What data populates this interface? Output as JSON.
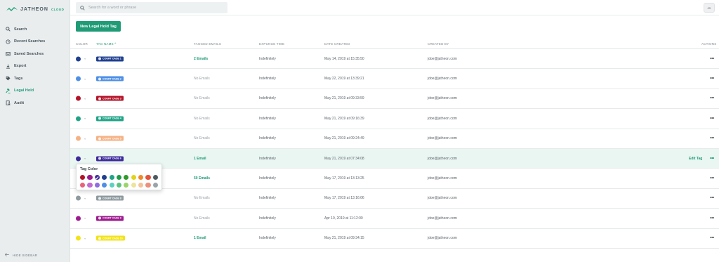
{
  "app": {
    "logo_text": "JATHEON",
    "logo_suffix": "CLOUD"
  },
  "sidebar": {
    "items": [
      {
        "label": "Search",
        "icon": "search-icon",
        "active": false
      },
      {
        "label": "Recent Searches",
        "icon": "history-icon",
        "active": false
      },
      {
        "label": "Saved Searches",
        "icon": "inbox-icon",
        "active": false
      },
      {
        "label": "Export",
        "icon": "download-icon",
        "active": false
      },
      {
        "label": "Tags",
        "icon": "tag-icon",
        "active": false
      },
      {
        "label": "Legal Hold",
        "icon": "gavel-icon",
        "active": true
      },
      {
        "label": "Audit",
        "icon": "audit-icon",
        "active": false
      }
    ],
    "hide_label": "HIDE SIDEBAR"
  },
  "topbar": {
    "search_placeholder": "Search for a word or phrase",
    "avatar_initials": "JD"
  },
  "main": {
    "new_button_label": "New Legal Hold Tag",
    "columns": {
      "color": "COLOR",
      "tag_name": "TAG NAME",
      "tagged_emails": "TAGGED EMAILS",
      "expunge_time": "EXPUNGE TIME",
      "date_created": "DATE CREATED",
      "created_by": "CREATED BY",
      "actions": "ACTIONS"
    },
    "sort_indicator": "^",
    "edit_label": "Edit Tag",
    "actions_glyph": "•••",
    "rows": [
      {
        "color": "#1f3f8f",
        "tag": "COURT CASE 1",
        "emails": "2 Emails",
        "has_emails": true,
        "expunge": "Indefinitely",
        "date": "May 14, 2019 at 15:35:50",
        "by": "jdoe@jatheon.com"
      },
      {
        "color": "#4d8fe6",
        "tag": "COURT CASE 2",
        "emails": "No Emails",
        "has_emails": false,
        "expunge": "Indefinitely",
        "date": "May 22, 2019 at 13:39:21",
        "by": "jdoe@jatheon.com"
      },
      {
        "color": "#b31227",
        "tag": "COURT CASE 3",
        "emails": "No Emails",
        "has_emails": false,
        "expunge": "Indefinitely",
        "date": "May 21, 2019 at 09:33:59",
        "by": "jdoe@jatheon.com"
      },
      {
        "color": "#1fa386",
        "tag": "COURT CASE 4",
        "emails": "No Emails",
        "has_emails": false,
        "expunge": "Indefinitely",
        "date": "May 21, 2019 at 09:16:39",
        "by": "jdoe@jatheon.com"
      },
      {
        "color": "#f5b183",
        "tag": "COURT CASE 5",
        "emails": "No Emails",
        "has_emails": false,
        "expunge": "Indefinitely",
        "date": "May 21, 2019 at 09:24:49",
        "by": "jdoe@jatheon.com"
      },
      {
        "color": "#3d2a9a",
        "tag": "COURT CASE 6",
        "emails": "1 Email",
        "has_emails": true,
        "expunge": "Indefinitely",
        "date": "May 21, 2019 at 07:34:08",
        "by": "jdoe@jatheon.com",
        "highlight": true
      },
      {
        "color": "#7a4bd0",
        "tag": "COURT CASE 7",
        "emails": "50 Emails",
        "has_emails": true,
        "expunge": "Indefinitely",
        "date": "May 17, 2019 at 13:13:25",
        "by": "jdoe@jatheon.com"
      },
      {
        "color": "#8e9a9f",
        "tag": "COURT CASE 8",
        "emails": "No Emails",
        "has_emails": false,
        "expunge": "Indefinitely",
        "date": "May 17, 2019 at 13:16:06",
        "by": "jdoe@jatheon.com"
      },
      {
        "color": "#9c1a8e",
        "tag": "COURT CASE 9",
        "emails": "No Emails",
        "has_emails": false,
        "expunge": "Indefinitely",
        "date": "Apr 19, 2019 at 11:12:00",
        "by": "jdoe@jatheon.com"
      },
      {
        "color": "#f2e319",
        "tag": "COURT CASE 10",
        "emails": "1 Email",
        "has_emails": true,
        "expunge": "Indefinitely",
        "date": "May 21, 2019 at 09:34:15",
        "by": "jdoe@jatheon.com"
      }
    ]
  },
  "tag_color_popover": {
    "title": "Tag Color",
    "selected_index": 2,
    "row1": [
      "#b31227",
      "#9c1a8e",
      "#3d2a9a",
      "#1f3f8f",
      "#1fa386",
      "#1f9b47",
      "#2e9a2a",
      "#e2d319",
      "#f0892a",
      "#e2533b",
      "#4e5a5f"
    ],
    "row2": [
      "#e8627a",
      "#c26ad0",
      "#8f6ae0",
      "#4d8fe6",
      "#5cd0c0",
      "#5cc37f",
      "#9ad56a",
      "#eee39a",
      "#f5c29a",
      "#ec8f7d",
      "#9aa4a8"
    ]
  }
}
